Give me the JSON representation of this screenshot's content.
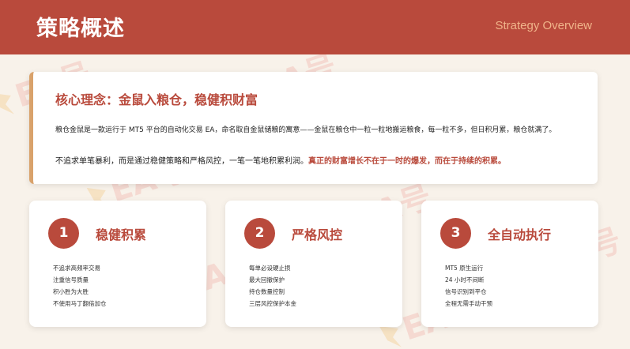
{
  "header": {
    "title": "策略概述",
    "subtitle": "Strategy Overview"
  },
  "watermark": {
    "text": "EA号"
  },
  "concept": {
    "title": "核心理念：金鼠入粮仓，稳健积财富",
    "paragraph1": "粮仓金鼠是一款运行于 MT5 平台的自动化交易 EA，命名取自金鼠储粮的寓意——金鼠在粮仓中一粒一粒地搬运粮食，每一粒不多，但日积月累，粮仓就满了。",
    "paragraph2_plain": "不追求单笔暴利，而是通过稳健策略和严格风控，一笔一笔地积累利润。",
    "paragraph2_highlight": "真正的财富增长不在于一时的爆发，而在于持续的积累。"
  },
  "features": [
    {
      "number": "1",
      "title": "稳健积累",
      "items": [
        "不追求高频率交易",
        "注重信号质量",
        "积小胜为大胜",
        "不使用马丁翻倍加仓"
      ]
    },
    {
      "number": "2",
      "title": "严格风控",
      "items": [
        "每单必设硬止损",
        "最大回撤保护",
        "持仓数量控制",
        "三层风控保护本金"
      ]
    },
    {
      "number": "3",
      "title": "全自动执行",
      "items": [
        "MT5 原生运行",
        "24 小时不间断",
        "信号识别到平仓",
        "全程无需手动干预"
      ]
    }
  ],
  "colors": {
    "brand": "#b94a3c",
    "accent": "#d9a26b",
    "background": "#f8f2ea"
  }
}
